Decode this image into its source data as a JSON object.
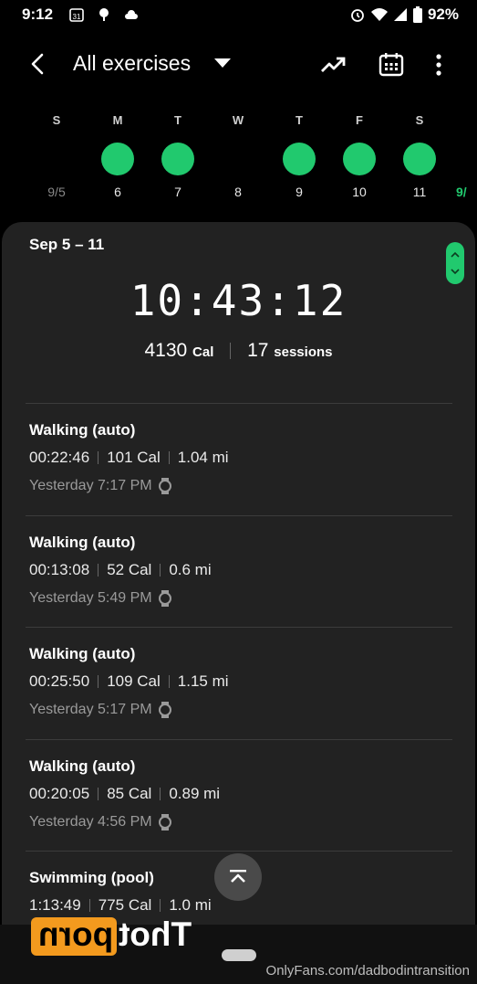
{
  "status": {
    "time": "9:12",
    "battery": "92%"
  },
  "header": {
    "title": "All exercises"
  },
  "week": {
    "letters": [
      "S",
      "M",
      "T",
      "W",
      "T",
      "F",
      "S"
    ],
    "numbers": [
      "9/5",
      "6",
      "7",
      "8",
      "9",
      "10",
      "11"
    ],
    "next_label": "9/",
    "active": [
      false,
      true,
      true,
      false,
      true,
      true,
      true
    ]
  },
  "summary": {
    "range": "Sep 5 – 11",
    "total_time": "10:43:12",
    "calories": "4130",
    "cal_unit": "Cal",
    "sessions": "17",
    "sessions_unit": "sessions"
  },
  "exercises": [
    {
      "title": "Walking (auto)",
      "duration": "00:22:46",
      "calories": "101 Cal",
      "distance": "1.04 mi",
      "time": "Yesterday 7:17 PM"
    },
    {
      "title": "Walking (auto)",
      "duration": "00:13:08",
      "calories": "52 Cal",
      "distance": "0.6 mi",
      "time": "Yesterday 5:49 PM"
    },
    {
      "title": "Walking (auto)",
      "duration": "00:25:50",
      "calories": "109 Cal",
      "distance": "1.15 mi",
      "time": "Yesterday 5:17 PM"
    },
    {
      "title": "Walking (auto)",
      "duration": "00:20:05",
      "calories": "85 Cal",
      "distance": "0.89 mi",
      "time": "Yesterday 4:56 PM"
    },
    {
      "title": "Swimming (pool)",
      "duration": "1:13:49",
      "calories": "775 Cal",
      "distance": "1.0 mi",
      "time": ""
    }
  ],
  "watermark": {
    "part1": "porn",
    "part2": "Thot",
    "credit": "OnlyFans.com/dadbodintransition"
  },
  "colors": {
    "accent": "#21c96e",
    "card": "#222222"
  }
}
